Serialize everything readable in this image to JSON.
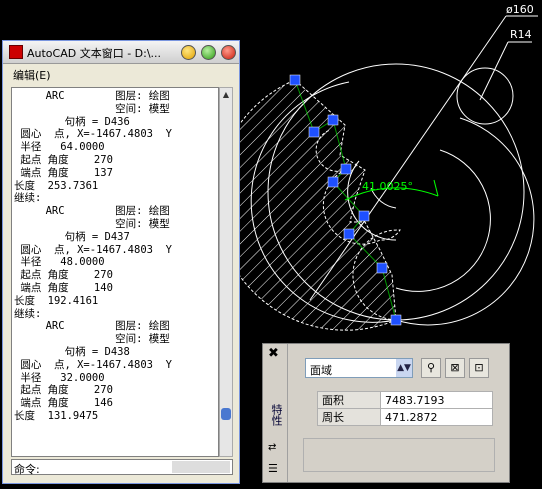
{
  "drawing": {
    "dim_diameter": "ø160",
    "dim_radius": "R14",
    "dim_angle": "41.0025°"
  },
  "text_window": {
    "title": "AutoCAD 文本窗口 - D:\\...",
    "menu_edit": "编辑(E)",
    "lines": [
      "     ARC        图层: 绘图",
      "                空间: 模型",
      "        句柄 = D436",
      " 圆心  点, X=-1467.4803  Y",
      " 半径   64.0000",
      " 起点 角度    270",
      " 端点 角度    137",
      "长度  253.7361",
      "继续:",
      "     ARC        图层: 绘图",
      "                空间: 模型",
      "        句柄 = D437",
      " 圆心  点, X=-1467.4803  Y",
      " 半径   48.0000",
      " 起点 角度    270",
      " 端点 角度    140",
      "长度  192.4161",
      "继续:",
      "     ARC        图层: 绘图",
      "                空间: 模型",
      "        句柄 = D438",
      " 圆心  点, X=-1467.4803  Y",
      " 半径   32.0000",
      " 起点 角度    270",
      " 端点 角度    146",
      "长度  131.9475"
    ],
    "command_label": "命令:"
  },
  "properties": {
    "side_title": "特性",
    "object_type": "面域",
    "rows": [
      {
        "key": "面积",
        "value": "7483.7193"
      },
      {
        "key": "周长",
        "value": "471.2872"
      }
    ]
  },
  "colors": {
    "background": "#000000",
    "geometry": "#ffffff",
    "grip": "#1e50ff",
    "dimension": "#00ff00"
  }
}
